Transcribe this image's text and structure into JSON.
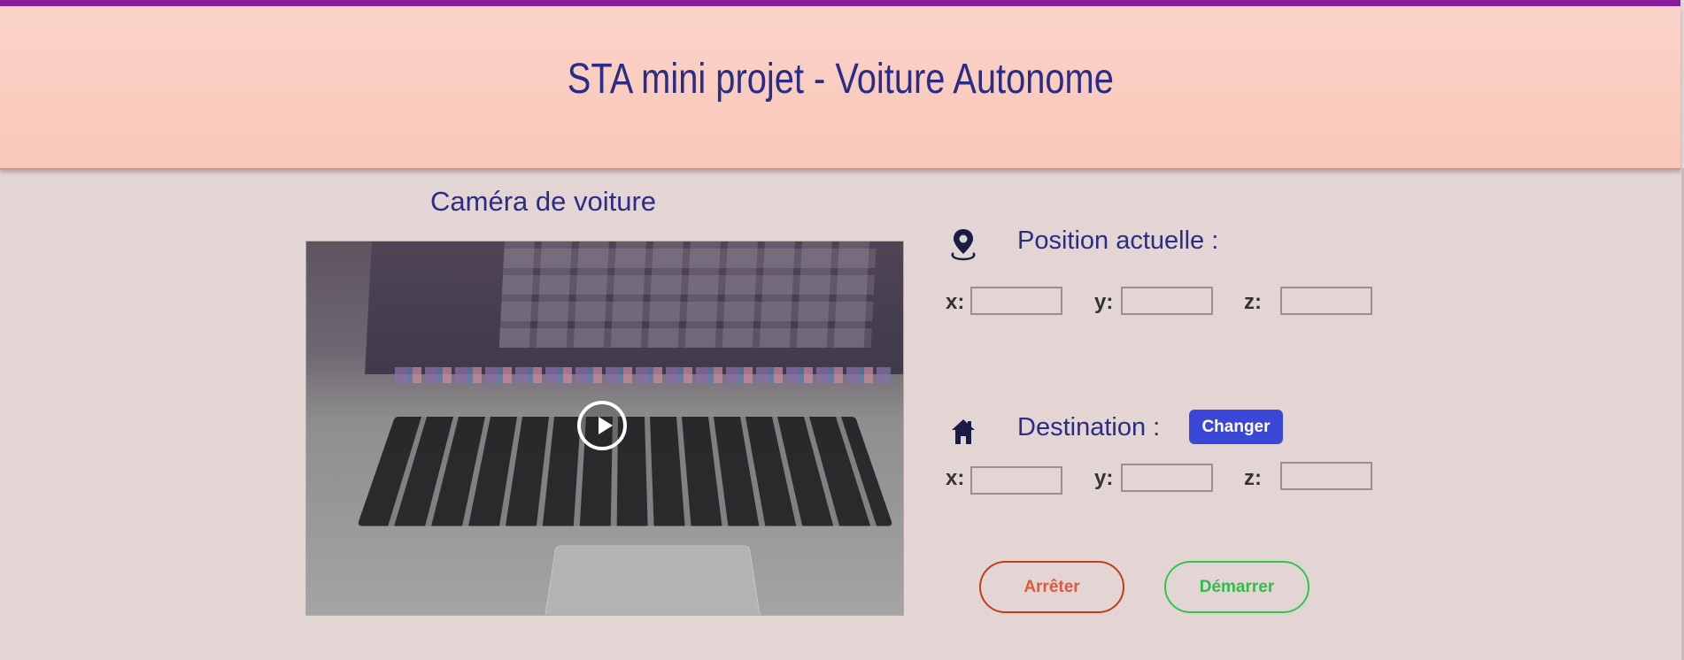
{
  "header": {
    "title": "STA mini projet - Voiture Autonome"
  },
  "camera": {
    "label": "Caméra de voiture"
  },
  "position": {
    "label": "Position actuelle :",
    "icon": "map-pin-icon",
    "x_label": "x:",
    "y_label": "y:",
    "z_label": "z:",
    "x_value": "",
    "y_value": "",
    "z_value": ""
  },
  "destination": {
    "label": "Destination :",
    "icon": "home-icon",
    "change_label": "Changer",
    "x_label": "x:",
    "y_label": "y:",
    "z_label": "z:",
    "x_value": "",
    "y_value": "",
    "z_value": ""
  },
  "controls": {
    "stop_label": "Arrêter",
    "start_label": "Démarrer"
  },
  "colors": {
    "header_bg": "#fbd3c9",
    "page_bg": "#e4d5d5",
    "title_text": "#2a2c86",
    "change_button": "#3b47d6",
    "stop_accent": "#c83a1a",
    "start_accent": "#2ec650"
  }
}
